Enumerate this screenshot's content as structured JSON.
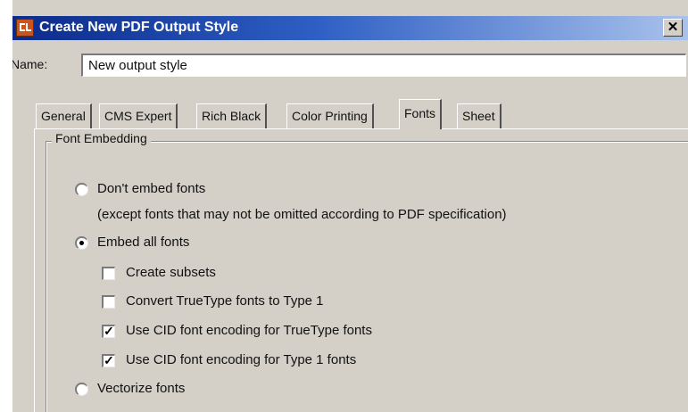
{
  "window": {
    "title": "Create New PDF Output Style",
    "close_glyph": "✕"
  },
  "name_field": {
    "label": "Name:",
    "value": "New output style"
  },
  "tabs": [
    {
      "label": "General",
      "active": false
    },
    {
      "label": "CMS Expert",
      "active": false
    },
    {
      "label": "Rich Black",
      "active": false
    },
    {
      "label": "Color Printing",
      "active": false
    },
    {
      "label": "Fonts",
      "active": true
    },
    {
      "label": "Sheet",
      "active": false
    }
  ],
  "font_embedding": {
    "group_label": "Font Embedding",
    "options": {
      "dont_embed": {
        "label": "Don't embed fonts",
        "selected": false
      },
      "dont_embed_note": "(except fonts that may not be omitted according to PDF specification)",
      "embed_all": {
        "label": "Embed all fonts",
        "selected": true
      },
      "create_subsets": {
        "label": "Create subsets",
        "checked": false
      },
      "convert_truetype": {
        "label": "Convert TrueType fonts to Type 1",
        "checked": false
      },
      "cid_truetype": {
        "label": "Use CID font encoding for TrueType fonts",
        "checked": true
      },
      "cid_type1": {
        "label": "Use CID font encoding for Type 1 fonts",
        "checked": true
      },
      "vectorize": {
        "label": "Vectorize fonts",
        "selected": false
      }
    }
  },
  "colors": {
    "titlebar_start": "#0a2a8a",
    "titlebar_end": "#a9c2ec",
    "dialog_bg": "#d4d0c8"
  },
  "icons": {
    "app": "app-icon",
    "close": "close-icon",
    "check": "checkmark-icon"
  }
}
